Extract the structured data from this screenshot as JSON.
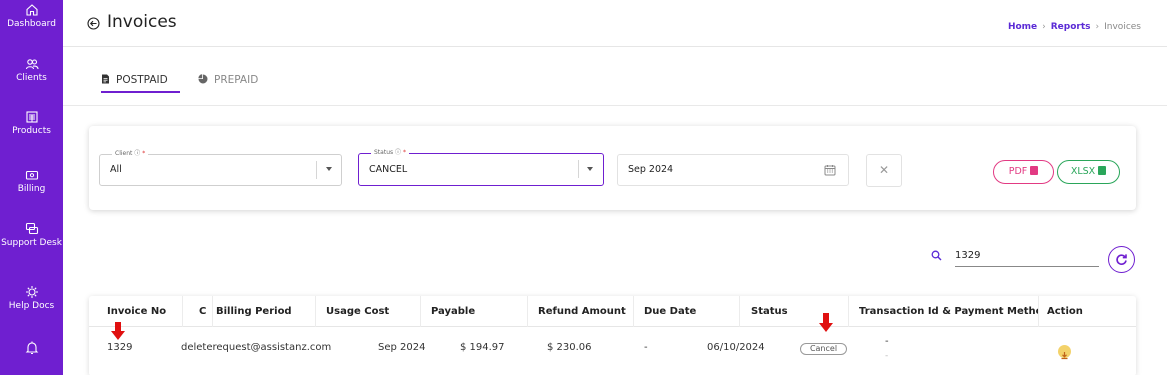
{
  "sidebar": {
    "items": [
      {
        "label": "Dashboard",
        "icon": "home-icon"
      },
      {
        "label": "Clients",
        "icon": "users-icon"
      },
      {
        "label": "Products",
        "icon": "products-icon"
      },
      {
        "label": "Billing",
        "icon": "billing-icon"
      },
      {
        "label": "Support Desk",
        "icon": "support-icon"
      },
      {
        "label": "Help Docs",
        "icon": "help-icon"
      },
      {
        "label": "",
        "icon": "bell-icon"
      }
    ],
    "color": "#6f1fd0"
  },
  "header": {
    "title": "Invoices",
    "breadcrumb": {
      "home": "Home",
      "reports": "Reports",
      "current": "Invoices"
    }
  },
  "tabs": [
    {
      "label": "POSTPAID",
      "active": true
    },
    {
      "label": "PREPAID",
      "active": false
    }
  ],
  "filters": {
    "client": {
      "label": "Client",
      "value": "All"
    },
    "status": {
      "label": "Status",
      "value": "CANCEL"
    },
    "period": {
      "value": "Sep 2024"
    },
    "clear_label": "✕",
    "pdf_label": "PDF",
    "xlsx_label": "XLSX"
  },
  "search": {
    "value": "1329"
  },
  "table": {
    "headers": [
      "Invoice No",
      "C",
      "Billing Period",
      "Usage Cost",
      "Payable",
      "Refund Amount",
      "Due Date",
      "Status",
      "Transaction Id & Payment Method",
      "Action"
    ],
    "rows": [
      {
        "invoice_no": "1329",
        "client": "deleterequest@assistanz.com",
        "billing_period": "Sep 2024",
        "usage_cost": "$ 194.97",
        "payable": "$ 230.06",
        "refund": "-",
        "due_date": "06/10/2024",
        "status": "Cancel",
        "transaction": "-",
        "transaction_sub": "-"
      }
    ]
  },
  "colors": {
    "accent": "#6f1fd0",
    "pdf": "#e23a83",
    "xlsx": "#2aa65a",
    "arrow": "#e01010"
  }
}
